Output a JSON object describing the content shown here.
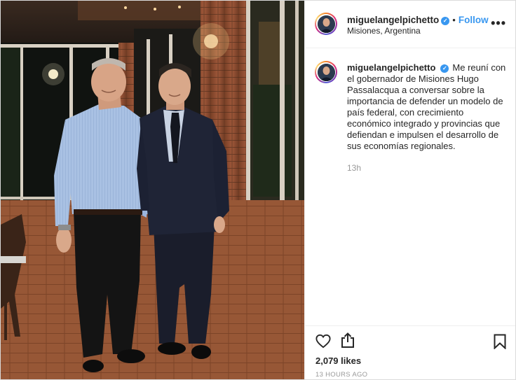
{
  "post": {
    "username": "miguelangelpichetto",
    "verified_icon": "verified-badge-icon",
    "follow_label": "Follow",
    "separator": "•",
    "location": "Misiones, Argentina",
    "more_icon": "more-options-icon",
    "more_label": "•••",
    "caption_text": "Me reuní con el gobernador de Misiones Hugo Passalacqua a conversar sobre la importancia de defender un modelo de país federal, con crecimiento económico integrado y provincias que defiendan e impulsen el desarrollo de sus economías regionales.",
    "time_ago": "13h",
    "likes": "2,079 likes",
    "posted": "13 HOURS AGO"
  },
  "icons": {
    "like": "heart-icon",
    "share": "share-icon",
    "save": "bookmark-icon"
  },
  "colors": {
    "accent": "#3897f0",
    "text": "#262626",
    "muted": "#999999",
    "border": "#efefef"
  }
}
